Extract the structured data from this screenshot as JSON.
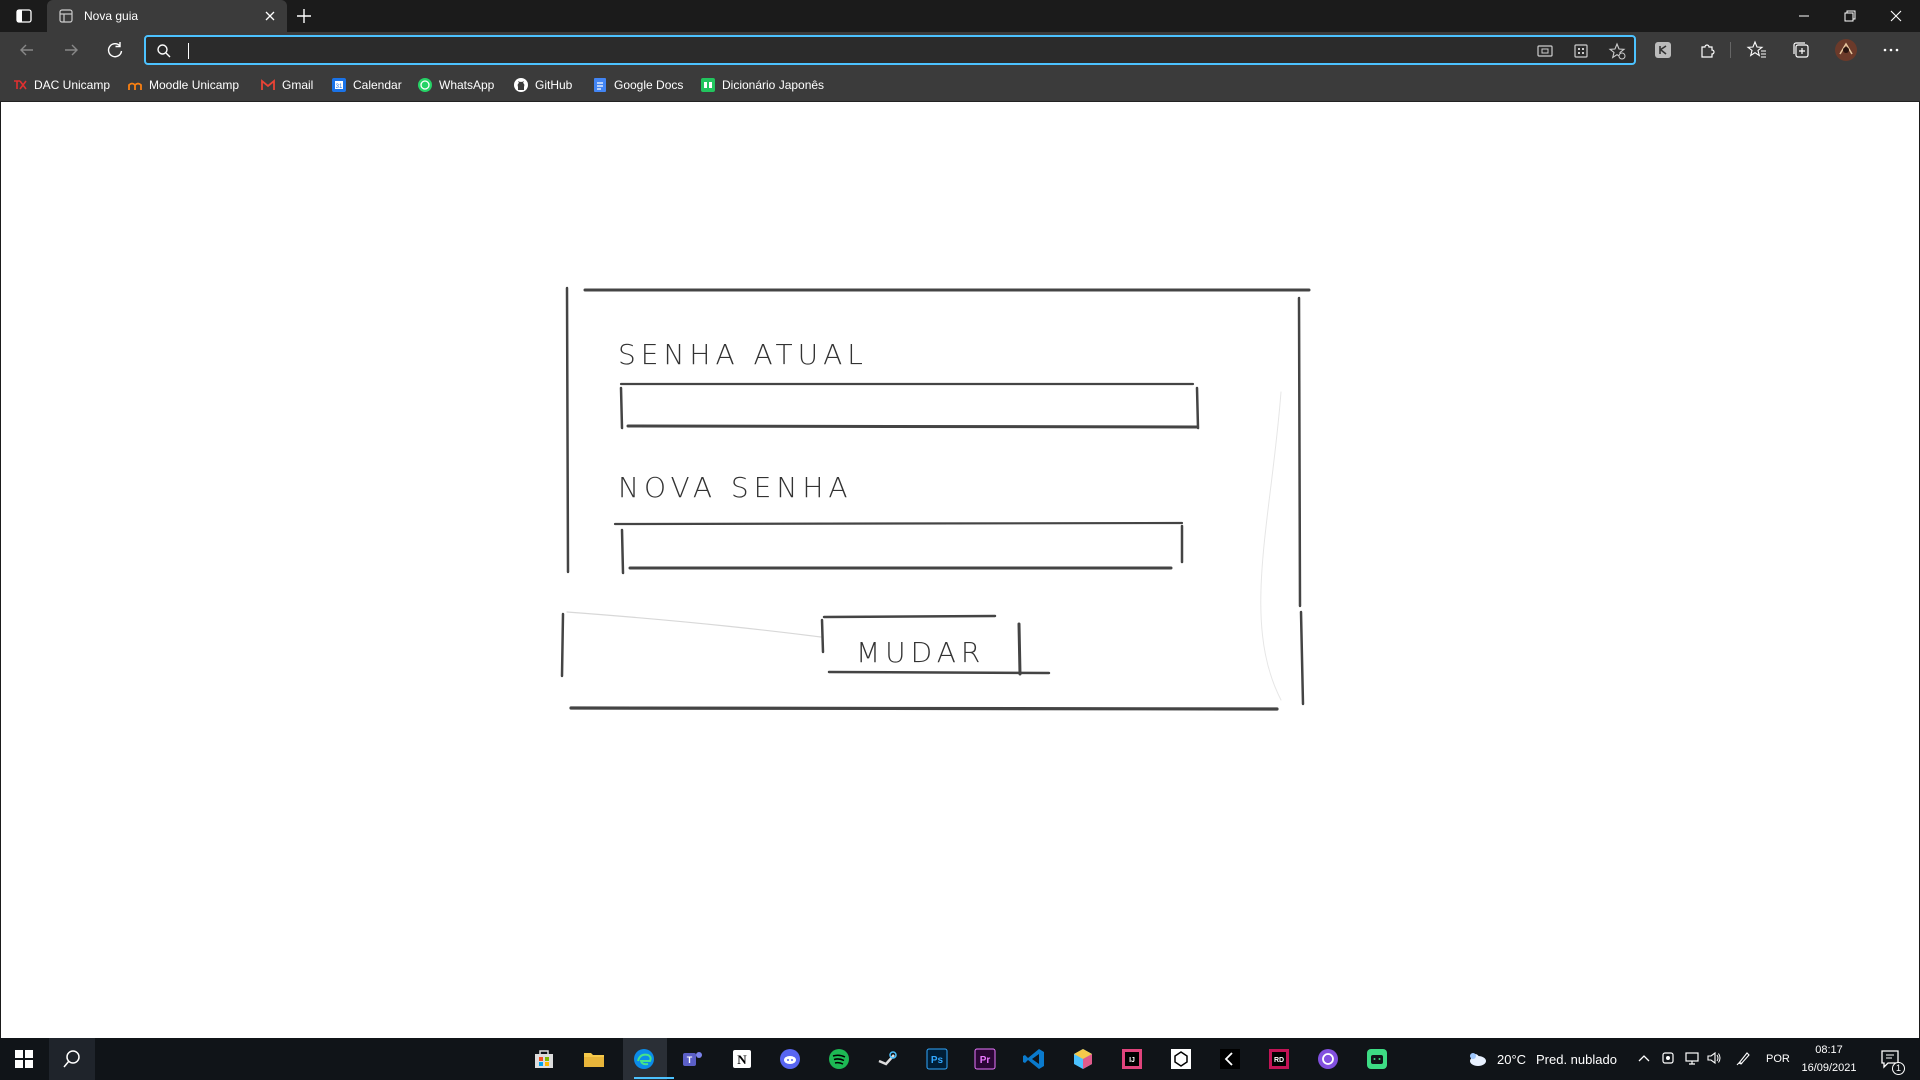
{
  "browser": {
    "tab": {
      "title": "Nova guia"
    },
    "address_bar": {
      "value": "",
      "placeholder": ""
    },
    "bookmarks": [
      {
        "label": "DAC Unicamp"
      },
      {
        "label": "Moodle Unicamp"
      },
      {
        "label": "Gmail"
      },
      {
        "label": "Calendar"
      },
      {
        "label": "WhatsApp"
      },
      {
        "label": "GitHub"
      },
      {
        "label": "Google Docs"
      },
      {
        "label": "Dicionário Japonês"
      }
    ]
  },
  "sketch": {
    "current_password_label": "SENHA ATUAL",
    "new_password_label": "NOVA SENHA",
    "submit_label": "MUDAR"
  },
  "taskbar": {
    "apps": [
      "store",
      "file-explorer",
      "edge",
      "teams",
      "notion",
      "discord",
      "spotify",
      "steam",
      "photoshop",
      "premiere",
      "vscode",
      "blender",
      "intellij",
      "unity",
      "epic-games",
      "rider",
      "github-desktop",
      "android-studio"
    ],
    "weather": {
      "temp": "20°C",
      "condition": "Pred. nublado"
    },
    "language": "POR",
    "time": "08:17",
    "date": "16/09/2021",
    "notification_count": "1"
  },
  "colors": {
    "accent": "#4cc2ff",
    "tab_bar": "#1b1b1b",
    "toolbar": "#3b3b3b",
    "taskbar": "#101418"
  }
}
